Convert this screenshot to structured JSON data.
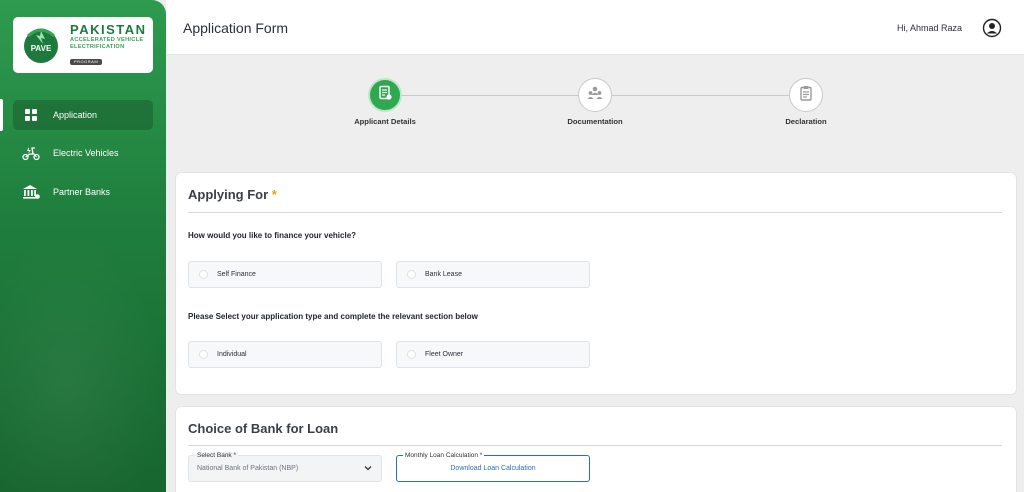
{
  "logo": {
    "title": "PAKISTAN",
    "sub1": "ACCELERATED VEHICLE",
    "sub2": "ELECTRIFICATION",
    "program": "PROGRAM",
    "mark_text": "PAVE"
  },
  "sidebar": {
    "items": [
      {
        "label": "Application",
        "icon": "grid-icon",
        "active": true
      },
      {
        "label": "Electric Vehicles",
        "icon": "scooter-icon",
        "active": false
      },
      {
        "label": "Partner Banks",
        "icon": "bank-icon",
        "active": false
      }
    ]
  },
  "header": {
    "title": "Application Form",
    "greeting": "Hi, Ahmad Raza"
  },
  "stepper": {
    "steps": [
      {
        "label": "Applicant Details",
        "icon": "document-icon",
        "active": true
      },
      {
        "label": "Documentation",
        "icon": "people-icon",
        "active": false
      },
      {
        "label": "Declaration",
        "icon": "clipboard-icon",
        "active": false
      }
    ]
  },
  "applying_for": {
    "title": "Applying For",
    "required_mark": "*",
    "finance_question": "How would you like to finance your vehicle?",
    "finance_options": [
      "Self Finance",
      "Bank Lease"
    ],
    "type_question": "Please Select your application type and complete the relevant section below",
    "type_options": [
      "Individual",
      "Fleet Owner"
    ]
  },
  "bank_choice": {
    "title": "Choice of Bank for Loan",
    "select_label": "Select Bank *",
    "select_value": "National Bank of Pakistan (NBP)",
    "calc_label": "Monthly Loan Calculation *",
    "calc_link": "Download Loan Calculation"
  },
  "colors": {
    "brand_green": "#2fa84f",
    "sidebar_dark": "#17652f",
    "accent_orange": "#f59e0b",
    "link_blue": "#2c6fb7"
  }
}
